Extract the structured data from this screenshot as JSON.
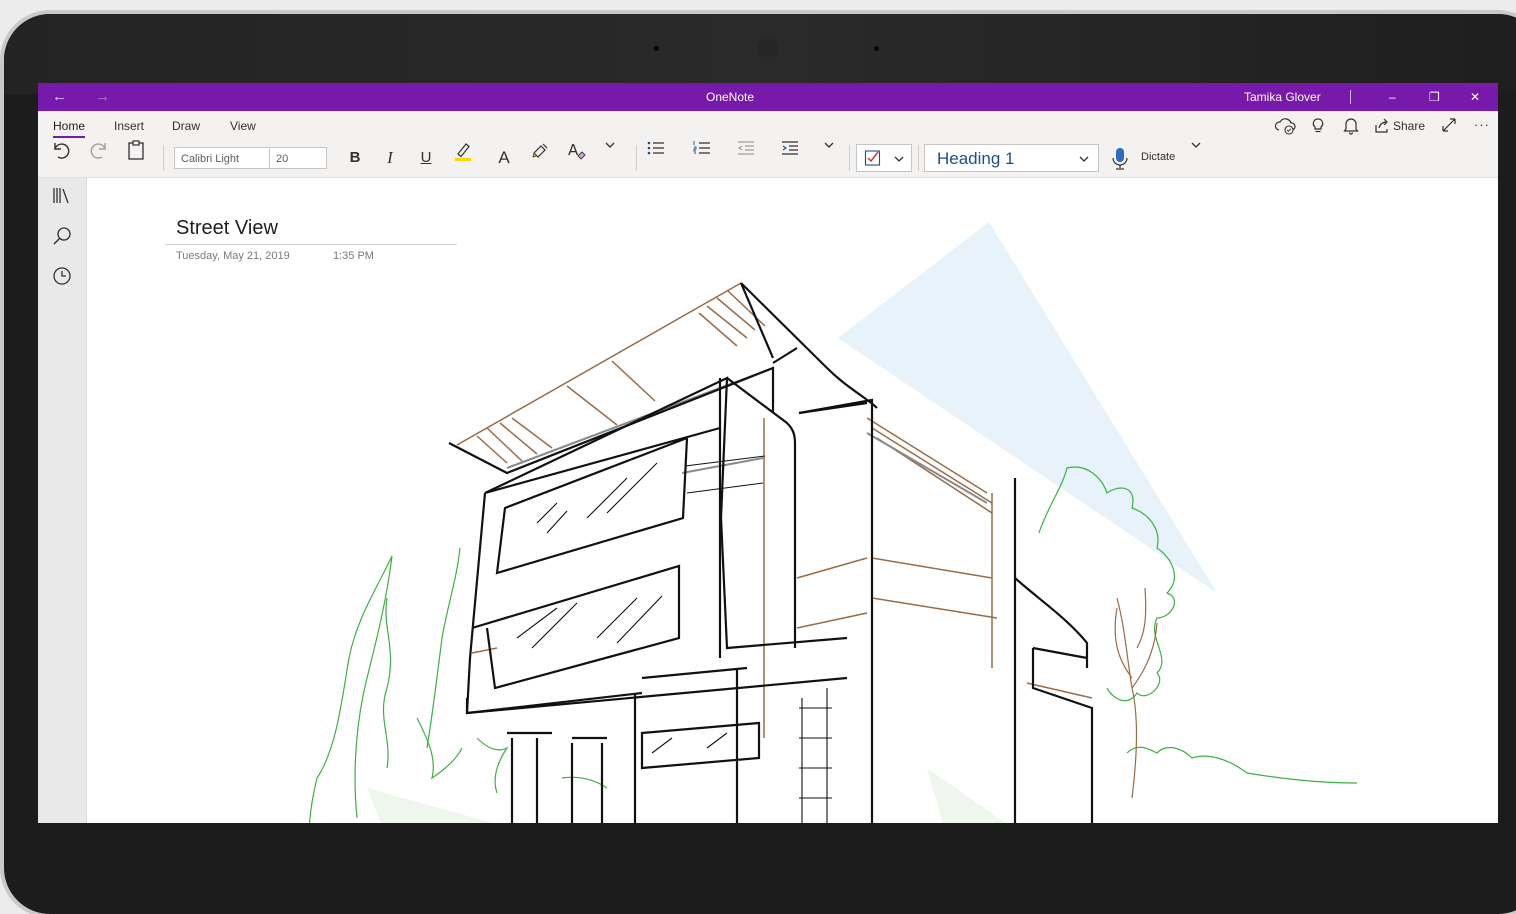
{
  "window": {
    "app_title": "OneNote",
    "user_name": "Tamika Glover",
    "back_glyph": "←",
    "forward_glyph": "→",
    "minimize_glyph": "–",
    "restore_glyph": "❐",
    "close_glyph": "✕",
    "titlebar_color": "#7719aa"
  },
  "ribbon": {
    "tabs": [
      {
        "label": "Home",
        "active": true
      },
      {
        "label": "Insert",
        "active": false
      },
      {
        "label": "Draw",
        "active": false
      },
      {
        "label": "View",
        "active": false
      }
    ],
    "share_label": "Share",
    "more_glyph": "···",
    "font_name": "Calibri Light",
    "font_size": "20",
    "bold": "B",
    "italic": "I",
    "underline": "U",
    "font_color_glyph": "A",
    "style_value": "Heading 1",
    "dictate_label": "Dictate",
    "icons": [
      "undo-icon",
      "redo-icon",
      "clipboard-icon",
      "highlighter-icon",
      "format-painter-icon",
      "clear-format-icon",
      "bullets-icon",
      "numbering-icon",
      "outdent-icon",
      "indent-icon",
      "todo-tag-icon",
      "microphone-icon",
      "sync-icon",
      "lightbulb-icon",
      "bell-icon",
      "share-icon",
      "fullscreen-icon"
    ]
  },
  "sidebar": {
    "icons": [
      "notebooks-icon",
      "search-icon",
      "recent-icon"
    ]
  },
  "page": {
    "title": "Street View",
    "date": "Tuesday, May 21, 2019",
    "time": "1:35 PM"
  },
  "colors": {
    "ink_black": "#111111",
    "ink_brown": "#9b6b45",
    "ink_green": "#3cb043",
    "ink_gray": "#8a8a8a",
    "light_beam": "#e8f2fa",
    "accent_blue": "#1e4e8c"
  }
}
